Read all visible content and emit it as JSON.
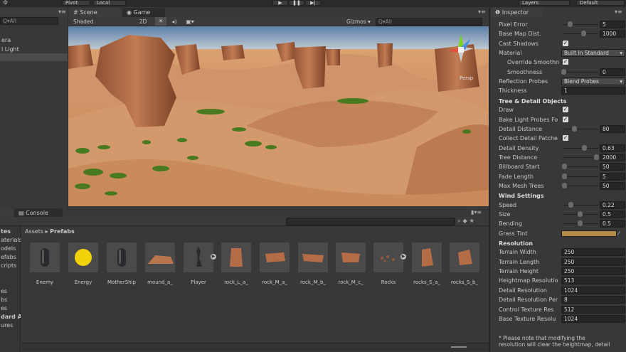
{
  "topbar": {
    "pivot_label": "Pivot",
    "local_label": "Local",
    "layers_label": "Layers",
    "layout_label": "Default",
    "colors": {
      "bar": "#2a2a2a"
    }
  },
  "hierarchy": {
    "search_placeholder": "Q▾All",
    "items": [
      "era",
      "l Light"
    ]
  },
  "scene": {
    "tabs": [
      {
        "label": "Scene"
      },
      {
        "label": "Game"
      }
    ],
    "shading_mode": "Shaded",
    "mode_2d": "2D",
    "gizmos_label": "Gizmos",
    "search_placeholder": "Q▾All",
    "persp_label": "Persp",
    "colors": {
      "sky_top": "#5d7fa7",
      "sky_bottom": "#d2d9de",
      "sand": "#c98a5c",
      "rock": "#a86442",
      "grass": "#3f6a1c"
    }
  },
  "bottom": {
    "tabs": [
      {
        "label": ""
      },
      {
        "label": "Console"
      }
    ],
    "breadcrumb": {
      "root": "Assets",
      "sep": "▸",
      "current": "Prefabs"
    },
    "project_items": [
      "tes",
      "aterials",
      "odels",
      "efabs",
      "cripts",
      "es",
      "bs",
      "es",
      "dard As",
      "ures"
    ],
    "assets": [
      {
        "label": "Enemy",
        "icon": "capsule-icon"
      },
      {
        "label": "Energy",
        "icon": "sphere-icon"
      },
      {
        "label": "MotherShip",
        "icon": "capsule-icon"
      },
      {
        "label": "mound_a_",
        "icon": "mound-icon"
      },
      {
        "label": "Player",
        "icon": "figure-icon"
      },
      {
        "label": "rock_L_a_",
        "icon": "rock-icon"
      },
      {
        "label": "rock_M_a_",
        "icon": "rock-icon"
      },
      {
        "label": "rock_M_b_",
        "icon": "rock-icon"
      },
      {
        "label": "rock_M_c_",
        "icon": "rock-icon"
      },
      {
        "label": "Rocks",
        "icon": "rocks-icon"
      },
      {
        "label": "rocks_S_a_",
        "icon": "rock-icon"
      },
      {
        "label": "rocks_S_b_",
        "icon": "rock-icon"
      }
    ],
    "colors": {
      "energy": "#f2d20a"
    }
  },
  "inspector": {
    "tab_label": "Inspector",
    "rows": [
      {
        "label": "Pixel Error",
        "type": "slider",
        "fraction": 0.2,
        "value": "5"
      },
      {
        "label": "Base Map Dist.",
        "type": "slider",
        "fraction": 0.6,
        "value": "1000"
      },
      {
        "label": "Cast Shadows",
        "type": "check",
        "checked": true
      },
      {
        "label": "Material",
        "type": "dropdown",
        "value": "Built In Standard"
      },
      {
        "label": "Override Smoothn",
        "type": "check",
        "checked": true,
        "indent": true
      },
      {
        "label": "Smoothness",
        "type": "slider",
        "fraction": 0.0,
        "value": "0",
        "indent": true
      },
      {
        "label": "Reflection Probes",
        "type": "dropdown",
        "value": "Blend Probes"
      },
      {
        "label": "Thickness",
        "type": "field",
        "value": "1"
      },
      {
        "label": "Tree & Detail Objects",
        "type": "section"
      },
      {
        "label": "Draw",
        "type": "check",
        "checked": true
      },
      {
        "label": "Bake Light Probes Fo",
        "type": "check",
        "checked": true
      },
      {
        "label": "Detail Distance",
        "type": "slider",
        "fraction": 0.33,
        "value": "80"
      },
      {
        "label": "Collect Detail Patche",
        "type": "check",
        "checked": true
      },
      {
        "label": "Detail Density",
        "type": "slider",
        "fraction": 0.63,
        "value": "0.63"
      },
      {
        "label": "Tree Distance",
        "type": "slider",
        "fraction": 1.0,
        "value": "2000"
      },
      {
        "label": "Billboard Start",
        "type": "slider",
        "fraction": 0.02,
        "value": "50"
      },
      {
        "label": "Fade Length",
        "type": "slider",
        "fraction": 0.02,
        "value": "5"
      },
      {
        "label": "Max Mesh Trees",
        "type": "slider",
        "fraction": 0.02,
        "value": "50"
      },
      {
        "label": "Wind Settings",
        "type": "section"
      },
      {
        "label": "Speed",
        "type": "slider",
        "fraction": 0.22,
        "value": "0.22"
      },
      {
        "label": "Size",
        "type": "slider",
        "fraction": 0.5,
        "value": "0.5"
      },
      {
        "label": "Bending",
        "type": "slider",
        "fraction": 0.5,
        "value": "0.5"
      },
      {
        "label": "Grass Tint",
        "type": "color",
        "value": "#b38b45"
      },
      {
        "label": "Resolution",
        "type": "section"
      },
      {
        "label": "Terrain Width",
        "type": "field",
        "value": "250"
      },
      {
        "label": "Terrain Length",
        "type": "field",
        "value": "250"
      },
      {
        "label": "Terrain Height",
        "type": "field",
        "value": "250"
      },
      {
        "label": "Heightmap Resolutio",
        "type": "field",
        "value": "513"
      },
      {
        "label": "Detail Resolution",
        "type": "field",
        "value": "1024"
      },
      {
        "label": "Detail Resolution Per",
        "type": "field",
        "value": "8"
      },
      {
        "label": "Control Texture Res",
        "type": "field",
        "value": "512"
      },
      {
        "label": "Base Texture Resolu",
        "type": "field",
        "value": "1024"
      }
    ],
    "note_line1": "* Please note that modifying the",
    "note_line2": "resolution will clear the heightmap, detail"
  }
}
